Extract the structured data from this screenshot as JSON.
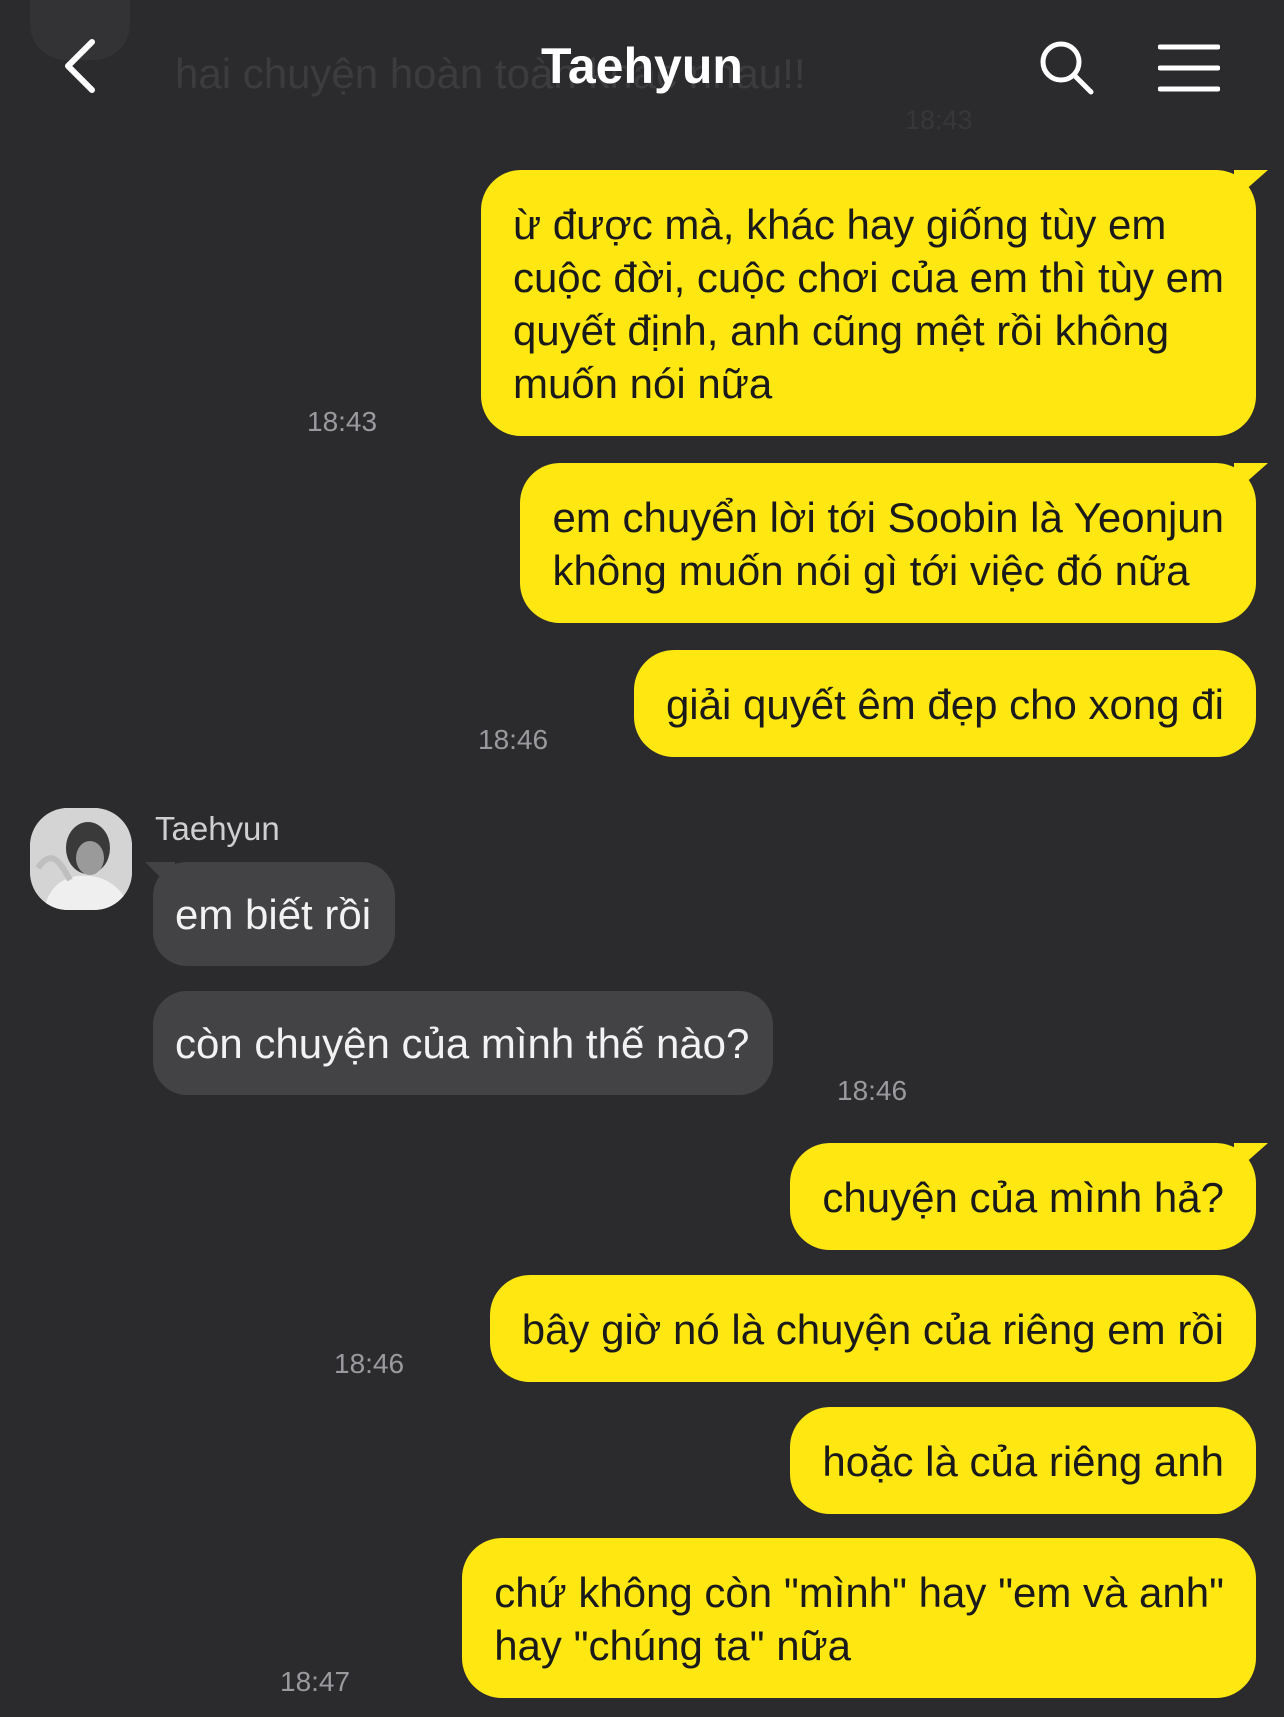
{
  "header": {
    "title": "Taehyun",
    "back_icon": "chevron-left-icon",
    "search_icon": "search-icon",
    "menu_icon": "hamburger-menu-icon"
  },
  "ghost": {
    "text": "hai chuyện hoàn toàn khác nhau!!",
    "time": "18:43"
  },
  "colors": {
    "background": "#2b2b2d",
    "outgoing_bubble": "#ffe812",
    "incoming_bubble": "#434346"
  },
  "messages": [
    {
      "dir": "out",
      "lines": [
        "ừ được mà, khác hay giống tùy em",
        "cuộc đời, cuộc chơi của em thì tùy em",
        "quyết định, anh cũng mệt rồi không",
        "muốn nói nữa"
      ],
      "time": "18:43"
    },
    {
      "dir": "out",
      "lines": [
        "em chuyển lời tới Soobin là Yeonjun",
        "không muốn nói gì tới việc đó nữa"
      ]
    },
    {
      "dir": "out",
      "lines": [
        "giải quyết êm đẹp cho xong đi"
      ],
      "time": "18:46"
    },
    {
      "dir": "in",
      "sender": "Taehyun",
      "lines": [
        "em biết rồi"
      ]
    },
    {
      "dir": "in",
      "lines": [
        "còn chuyện của mình thế nào?"
      ],
      "time": "18:46"
    },
    {
      "dir": "out",
      "lines": [
        "chuyện của mình hả?"
      ]
    },
    {
      "dir": "out",
      "lines": [
        "bây giờ nó là chuyện của riêng em rồi"
      ],
      "time": "18:46"
    },
    {
      "dir": "out",
      "lines": [
        "hoặc là của riêng anh"
      ]
    },
    {
      "dir": "out",
      "lines": [
        "chứ không còn \"mình\" hay \"em và anh\"",
        "hay \"chúng ta\" nữa"
      ],
      "time": "18:47"
    }
  ]
}
